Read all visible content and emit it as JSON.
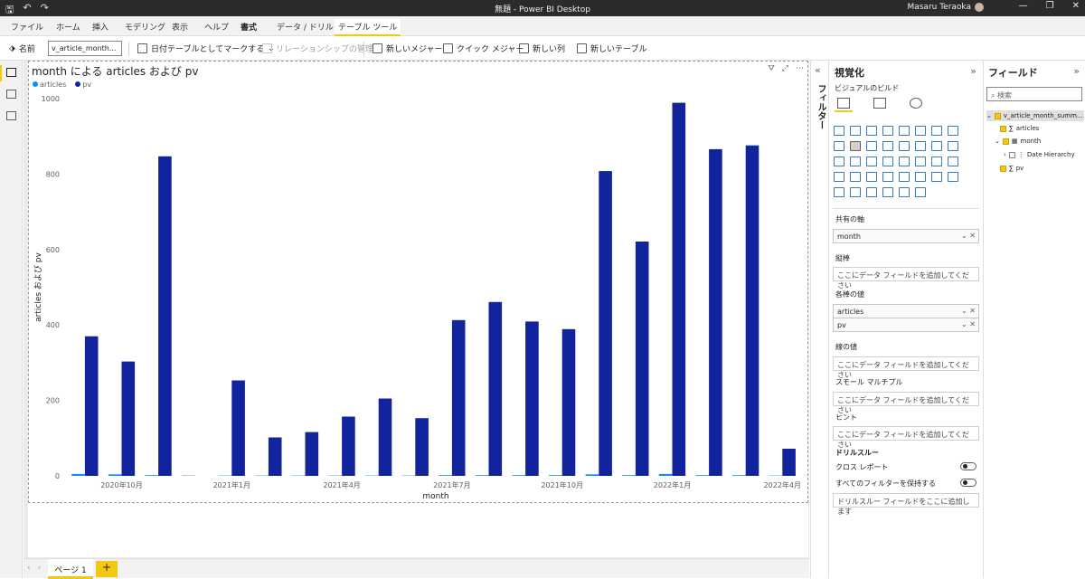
{
  "window": {
    "title": "無題 - Power BI Desktop",
    "user": "Masaru Teraoka"
  },
  "ribbon": {
    "tabs": [
      "ファイル",
      "ホーム",
      "挿入",
      "モデリング",
      "表示",
      "ヘルプ",
      "書式",
      "データ / ドリル",
      "テーブル ツール"
    ],
    "name_label": "名前",
    "name_value": "v_article_month...",
    "mark_date_table": "日付テーブルとしてマークする",
    "manage_relationships": "リレーションシップの管理",
    "new_measure": "新しいメジャー",
    "quick_measure": "クイック メジャー",
    "new_column": "新しい列",
    "new_table": "新しいテーブル"
  },
  "visual": {
    "title": "month による articles および pv",
    "legend": [
      {
        "name": "articles",
        "color": "#118DFF"
      },
      {
        "name": "pv",
        "color": "#12239E"
      }
    ]
  },
  "chart_data": {
    "type": "bar",
    "title": "month による articles および pv",
    "xlabel": "month",
    "ylabel": "articles および pv",
    "ylim": [
      0,
      1000
    ],
    "yticks": [
      0,
      200,
      400,
      600,
      800,
      1000
    ],
    "x_tick_labels": [
      "2020年10月",
      "2021年1月",
      "2021年4月",
      "2021年7月",
      "2021年10月",
      "2022年1月",
      "2022年4月"
    ],
    "categories": [
      "2020-09",
      "2020-10",
      "2020-11",
      "2020-12",
      "2021-01",
      "2021-02",
      "2021-03",
      "2021-04",
      "2021-05",
      "2021-06",
      "2021-07",
      "2021-08",
      "2021-09",
      "2021-10",
      "2021-11",
      "2021-12",
      "2022-01",
      "2022-02",
      "2022-03",
      "2022-04"
    ],
    "series": [
      {
        "name": "articles",
        "color": "#118DFF",
        "values": [
          5,
          4,
          2,
          1,
          1,
          1,
          1,
          1,
          1,
          1,
          2,
          2,
          2,
          2,
          4,
          2,
          5,
          2,
          2,
          1
        ]
      },
      {
        "name": "pv",
        "color": "#12239E",
        "values": [
          370,
          303,
          847,
          0,
          253,
          102,
          116,
          157,
          205,
          153,
          413,
          461,
          409,
          389,
          808,
          621,
          989,
          866,
          876,
          72
        ]
      }
    ]
  },
  "pages": {
    "tab1": "ページ 1",
    "add": "+"
  },
  "filters": {
    "label": "フィルター"
  },
  "viz": {
    "header": "視覚化",
    "build": "ビジュアルのビルド",
    "shared_axis": "共有の軸",
    "shared_axis_value": "month",
    "col_values": "縦棒",
    "add_field": "ここにデータ フィールドを追加してください",
    "col_y": "各棒の値",
    "col_y_values": [
      "articles",
      "pv"
    ],
    "line_values": "線の値",
    "small_multiples": "スモール マルチプル",
    "tooltips": "ヒント",
    "drillthrough": "ドリルスルー",
    "cross_report": "クロス レポート",
    "keep_filters": "すべてのフィルターを保持する",
    "drill_add": "ドリルスルー フィールドをここに追加します"
  },
  "fields": {
    "header": "フィールド",
    "search_placeholder": "検索",
    "table": "v_article_month_summ...",
    "articles": "articles",
    "month": "month",
    "date_hierarchy": "Date Hierarchy",
    "pv": "pv"
  }
}
